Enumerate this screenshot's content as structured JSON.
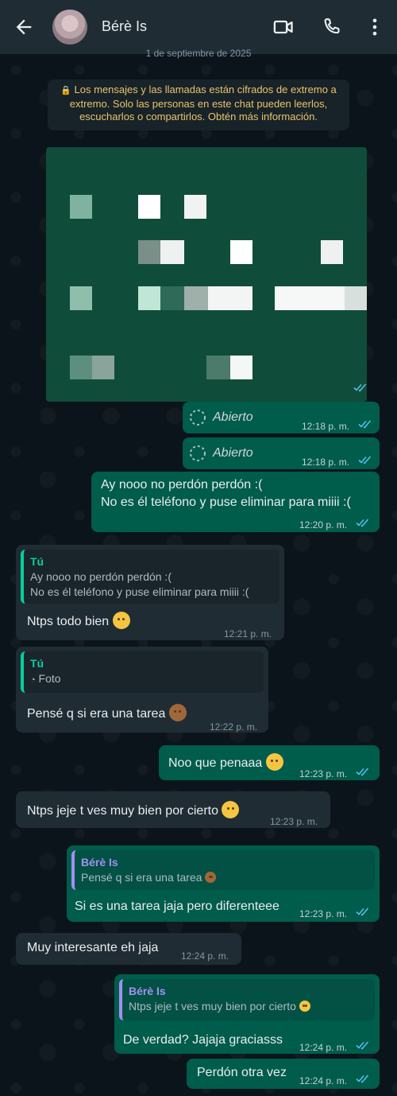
{
  "header": {
    "contact_name": "Bérè Is",
    "icons": [
      "back-arrow-icon",
      "avatar",
      "video-call-icon",
      "voice-call-icon",
      "more-options-icon"
    ]
  },
  "date_chip": "1 de septiembre de 2025",
  "encryption_notice": "Los mensajes y las llamadas están cifrados de extremo a extremo. Solo las personas en este chat pueden leerlos, escucharlos o compartirlos. Obtén más información.",
  "messages": [
    {
      "id": "m1",
      "dir": "out",
      "type": "view-once",
      "text": "Abierto",
      "time": "12:18 p. m."
    },
    {
      "id": "m2",
      "dir": "out",
      "type": "view-once",
      "text": "Abierto",
      "time": "12:18 p. m."
    },
    {
      "id": "m3",
      "dir": "out",
      "line1": "Ay nooo no perdón perdón :(",
      "line2": "No es él teléfono y puse eliminar para miiii :(",
      "time": "12:20 p. m."
    },
    {
      "id": "m4",
      "dir": "in",
      "quote_author": "Tú",
      "quote_line1": "Ay nooo no perdón perdón :(",
      "quote_line2": "No es él teléfono y puse eliminar para miiii :(",
      "text": "Ntps todo bien",
      "time": "12:21 p. m."
    },
    {
      "id": "m5",
      "dir": "in",
      "quote_author": "Tú",
      "quote_text": "Foto",
      "text": "Pensé q si era una tarea",
      "time": "12:22 p. m."
    },
    {
      "id": "m6",
      "dir": "out",
      "text": "Noo que penaaa",
      "time": "12:23 p. m."
    },
    {
      "id": "m7",
      "dir": "in",
      "text": "Ntps jeje t ves muy bien por cierto",
      "time": "12:23 p. m."
    },
    {
      "id": "m8",
      "dir": "out",
      "quote_author": "Bérè Is",
      "quote_text": "Pensé q si era una tarea",
      "text": "Si es una tarea jaja pero diferenteee",
      "time": "12:23 p. m."
    },
    {
      "id": "m9",
      "dir": "in",
      "text": "Muy interesante eh jaja",
      "time": "12:24 p. m."
    },
    {
      "id": "m10",
      "dir": "out",
      "quote_author": "Bérè Is",
      "quote_text": "Ntps jeje t ves muy bien por cierto",
      "text": "De verdad? Jajaja graciasss",
      "time": "12:24 p. m."
    },
    {
      "id": "m11",
      "dir": "out",
      "text": "Perdón otra vez",
      "time": "12:24 p. m."
    }
  ],
  "colors": {
    "outgoing_bubble": "#005c4b",
    "incoming_bubble": "#1f2c34",
    "read_ticks": "#53bdeb",
    "quote_accent_in": "#06cf9c",
    "quote_accent_out": "#a48ff5"
  }
}
